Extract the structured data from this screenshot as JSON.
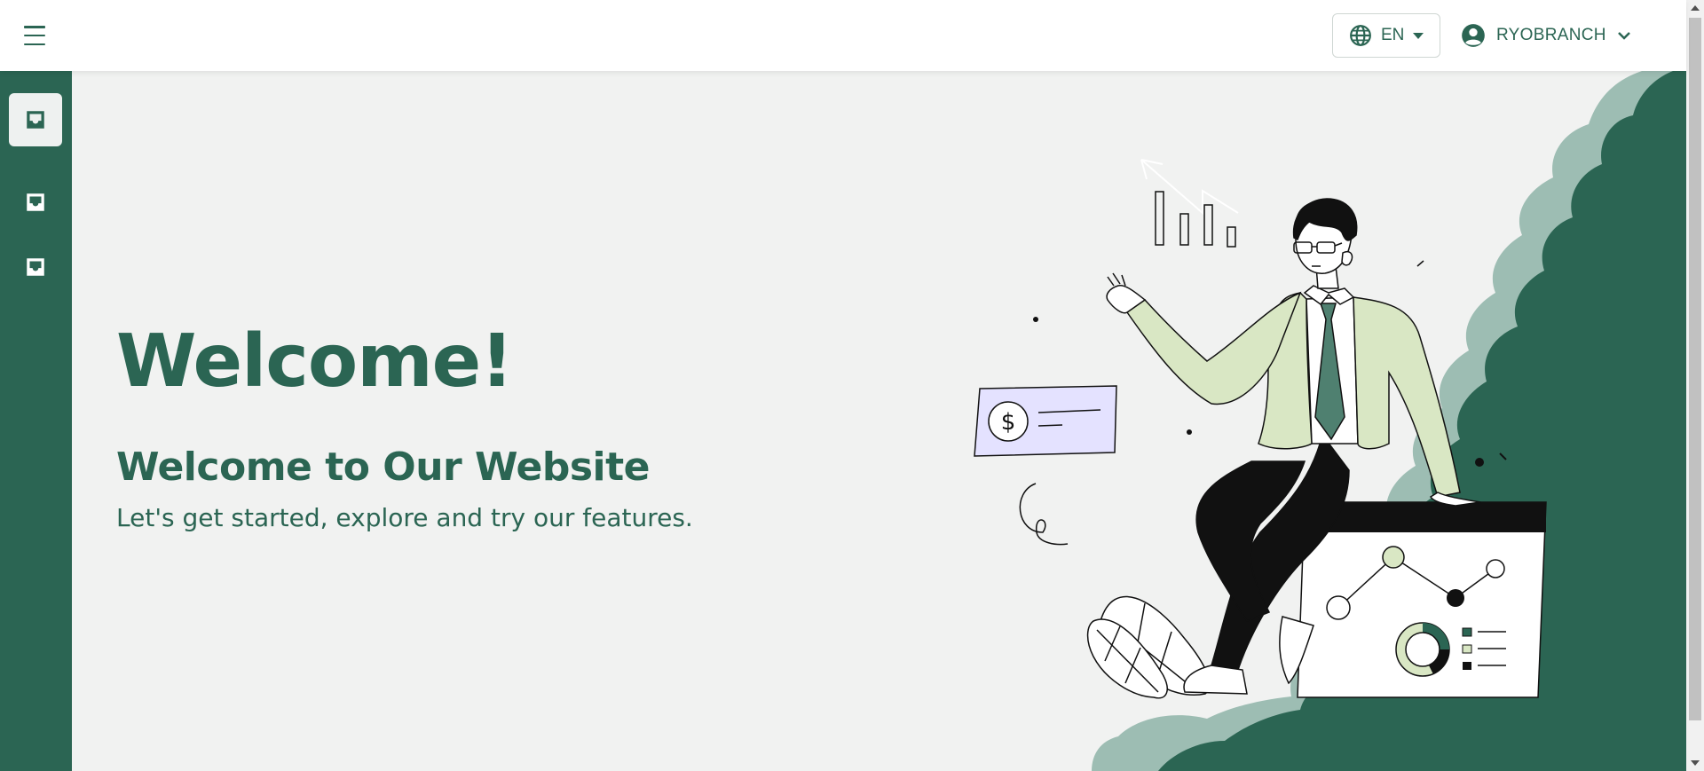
{
  "header": {
    "language": "EN",
    "user_name": "RYOBRANCH"
  },
  "sidebar": {
    "items": [
      {
        "icon": "inbox-icon",
        "active": true
      },
      {
        "icon": "inbox-icon",
        "active": false
      },
      {
        "icon": "inbox-icon",
        "active": false
      }
    ]
  },
  "hero": {
    "title": "Welcome!",
    "subtitle": "Welcome to Our Website",
    "description": "Let's get started, explore and try our features."
  },
  "colors": {
    "primary": "#2b6553",
    "background": "#f1f2f1",
    "light_green": "#d9e7c4",
    "lavender": "#e4e2ff"
  }
}
